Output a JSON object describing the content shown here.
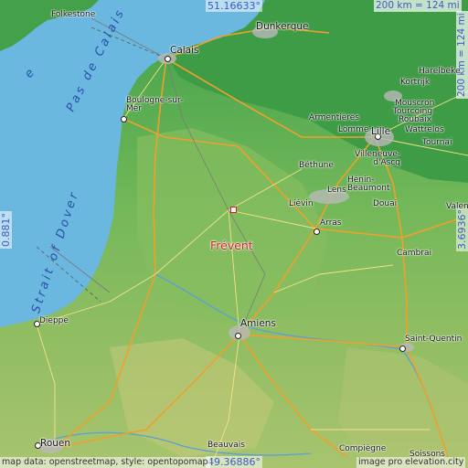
{
  "map": {
    "featured_place": "Frévent",
    "water": {
      "sea_label_1": "Strait of Dover",
      "sea_label_2": "Pas de Calais",
      "sea_fragment": "e"
    },
    "coordinates": {
      "top": "51.16633°",
      "bottom": "49.36886°",
      "left": "0.881°",
      "right": "3.6936°"
    },
    "scale": {
      "horizontal": "200 km = 124 mi",
      "vertical": "200 km = 124 mi"
    },
    "credits": {
      "left": "map data: openstreetmap, style: opentopomap",
      "right": "image pro  elevation.city"
    },
    "places": {
      "folkestone": "Folkestone",
      "calais": "Calais",
      "dunkerque": "Dunkerque",
      "boulogne": "Boulogne-sur-Mer",
      "harelbeke": "Harelbeke",
      "kortrijk": "Kortrijk",
      "mouscron": "Mouscron",
      "tourcoing": "Tourcoing",
      "roubaix": "Roubaix",
      "wattrelos": "Wattrelos",
      "armentieres": "Armentières",
      "lomme": "Lomme",
      "lille": "Lille",
      "villeneuve": "Villeneuve-d'Ascq",
      "tournai": "Tournai",
      "bethune": "Béthune",
      "henin": "Hénin-Beaumont",
      "lens": "Lens",
      "douai": "Douai",
      "lievin": "Liévin",
      "arras": "Arras",
      "valenciennes": "Valen",
      "cambrai": "Cambrai",
      "dieppe": "Dieppe",
      "amiens": "Amiens",
      "saint_quentin": "Saint-Quentin",
      "rouen": "Rouen",
      "beauvais": "Beauvais",
      "compiegne": "Compiègne",
      "soissons": "Soissons"
    }
  }
}
